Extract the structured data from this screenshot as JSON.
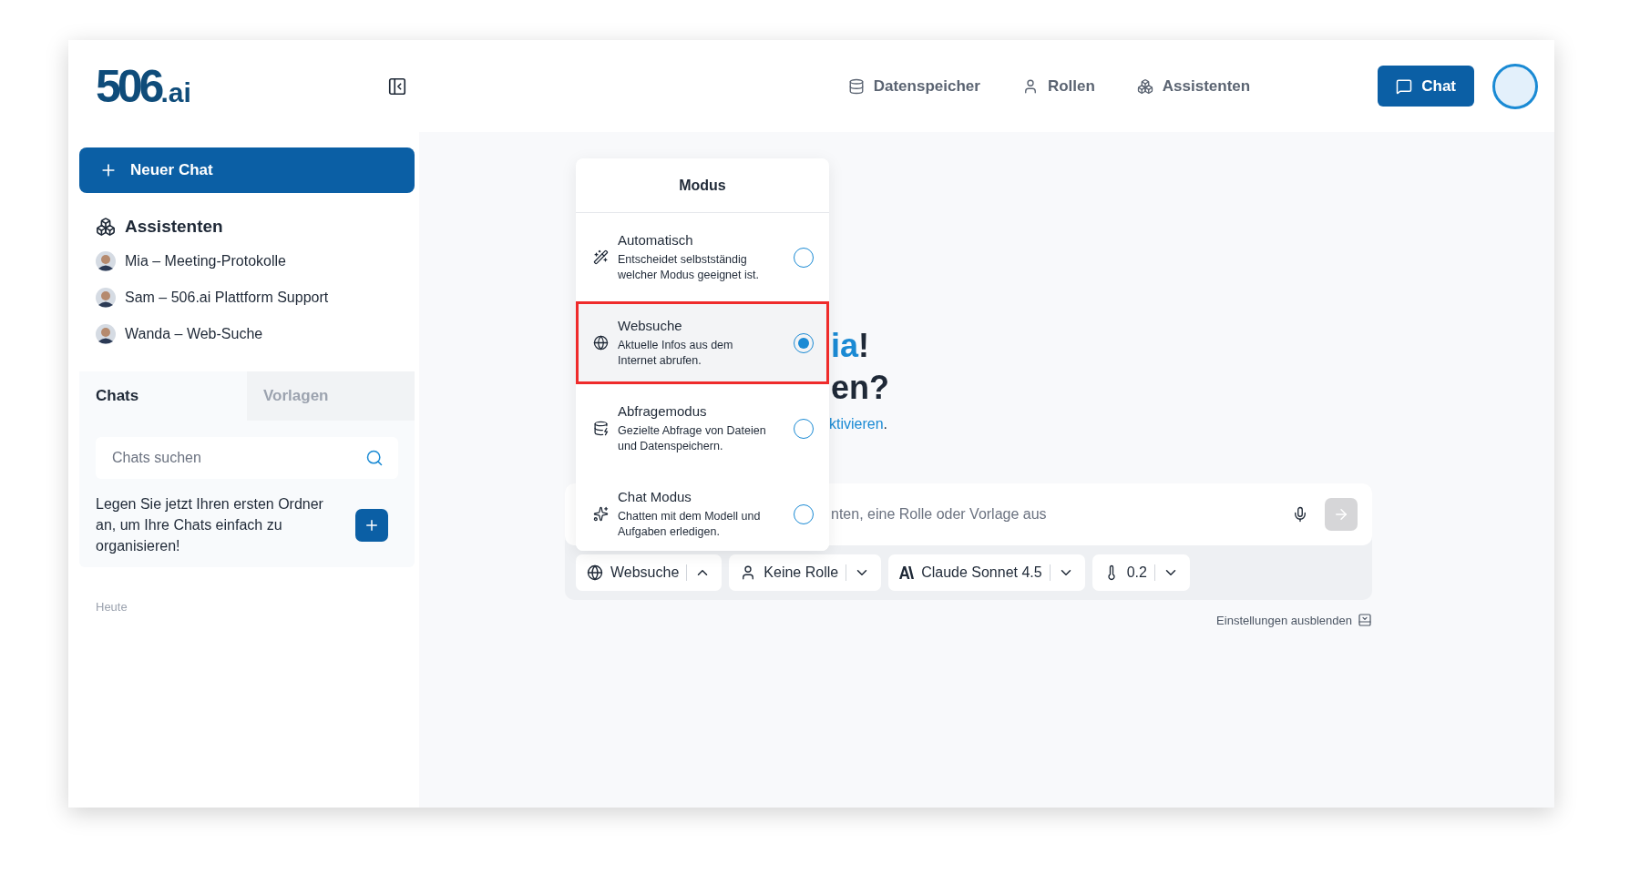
{
  "logo": {
    "main": "506",
    "suffix": ".ai"
  },
  "nav": [
    {
      "label": "Datenspeicher"
    },
    {
      "label": "Rollen"
    },
    {
      "label": "Assistenten"
    }
  ],
  "chat_button": "Chat",
  "sidebar": {
    "new_chat": "Neuer Chat",
    "assistants_title": "Assistenten",
    "assistants": [
      {
        "name": "Mia – Meeting-Protokolle"
      },
      {
        "name": "Sam – 506.ai Plattform Support"
      },
      {
        "name": "Wanda – Web-Suche"
      }
    ],
    "tabs": [
      {
        "label": "Chats",
        "selected": true
      },
      {
        "label": "Vorlagen",
        "selected": false
      }
    ],
    "search": {
      "placeholder": "Chats suchen"
    },
    "folder_hint": "Legen Sie jetzt Ihren ersten Ordner an, um Ihre Chats einfach zu organisieren!",
    "section": "Heute"
  },
  "heading": {
    "line_1_accent": "ia",
    "line_1_rest": "!",
    "line_2": "en?",
    "link": "ktivieren",
    "link_after": "."
  },
  "mode_menu": {
    "title": "Modus",
    "options": [
      {
        "title": "Automatisch",
        "description": "Entscheidet selbstständig welcher Modus geeignet ist.",
        "selected": false
      },
      {
        "title": "Websuche",
        "description": "Aktuelle Infos aus dem Internet abrufen.",
        "selected": true
      },
      {
        "title": "Abfragemodus",
        "description": "Gezielte Abfrage von Dateien und Datenspeichern.",
        "selected": false
      },
      {
        "title": "Chat Modus",
        "description": "Chatten mit dem Modell und Aufgaben erledigen.",
        "selected": false
      }
    ]
  },
  "composer": {
    "placeholder": "nten, eine Rolle oder Vorlage aus",
    "chips": [
      {
        "label": "Websuche",
        "expanded": true
      },
      {
        "label": "Keine Rolle",
        "expanded": false
      },
      {
        "label": "Claude Sonnet 4.5",
        "expanded": false
      },
      {
        "label": "0.2",
        "expanded": false
      }
    ]
  },
  "settings_toggle": "Einstellungen ausblenden"
}
